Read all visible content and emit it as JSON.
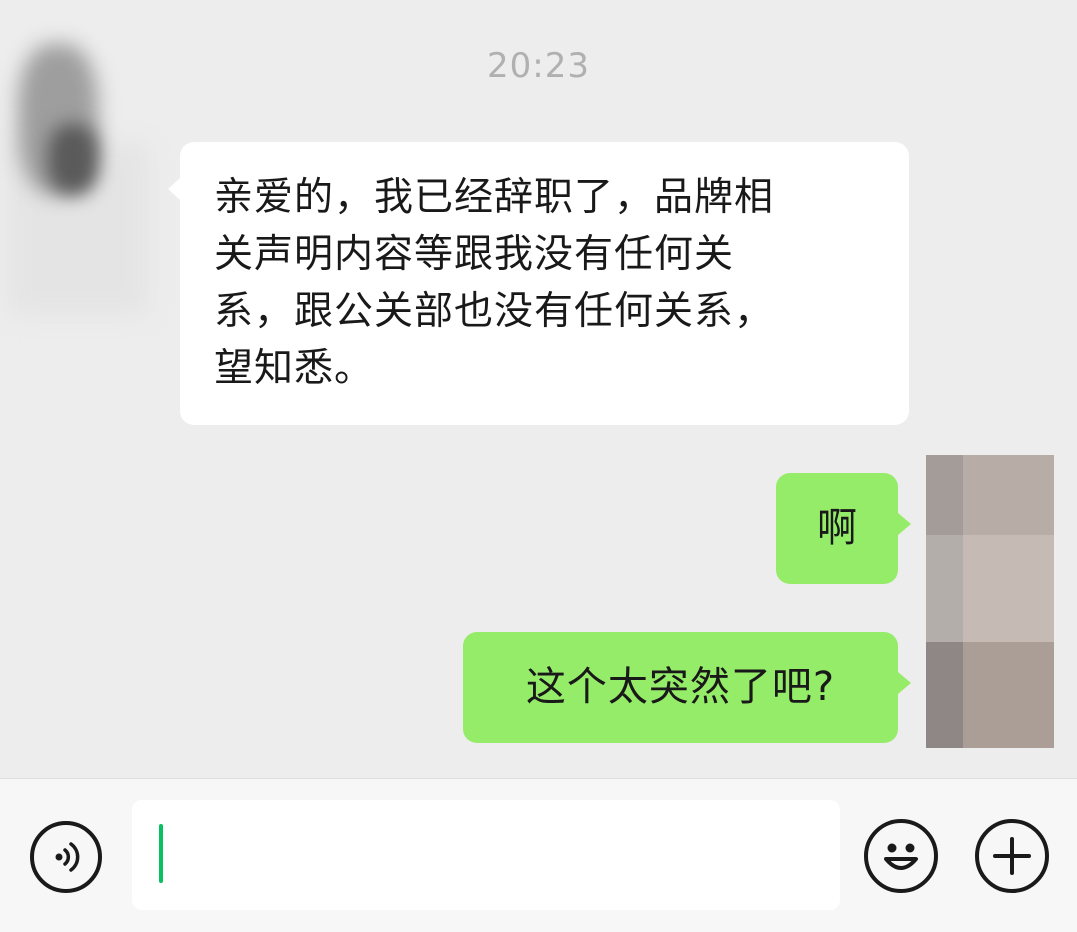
{
  "chat": {
    "timestamp": "20:23",
    "messages": [
      {
        "direction": "incoming",
        "lines": [
          "亲爱的，我已经辞职了，品牌相",
          "关声明内容等跟我没有任何关",
          "系，跟公关部也没有任何关系，",
          "望知悉。"
        ]
      },
      {
        "direction": "outgoing",
        "text": "啊"
      },
      {
        "direction": "outgoing",
        "text": "这个太突然了吧?"
      }
    ]
  },
  "input_bar": {
    "value": "",
    "icons": {
      "voice": "voice-icon",
      "emoji": "emoji-icon",
      "more": "plus-icon"
    }
  },
  "colors": {
    "background": "#ededed",
    "incoming_bubble": "#ffffff",
    "outgoing_bubble": "#95ec69",
    "caret": "#07c160",
    "timestamp": "#b0b0b0"
  }
}
